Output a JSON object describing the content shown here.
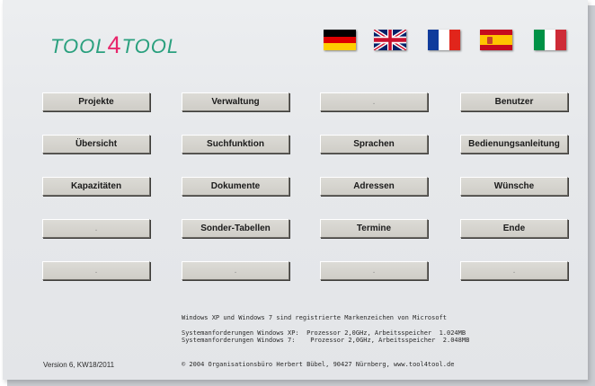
{
  "app": {
    "logo_prefix": "TOOL",
    "logo_four": "4",
    "logo_suffix": "TOOL"
  },
  "flags": [
    {
      "name": "german-flag-icon"
    },
    {
      "name": "uk-flag-icon"
    },
    {
      "name": "french-flag-icon"
    },
    {
      "name": "spanish-flag-icon"
    },
    {
      "name": "italian-flag-icon"
    }
  ],
  "menu": {
    "row1": [
      "Projekte",
      "Verwaltung",
      ".",
      "Benutzer"
    ],
    "row2": [
      "Übersicht",
      "Suchfunktion",
      "Sprachen",
      "Bedienungsanleitung"
    ],
    "row3": [
      "Kapazitäten",
      "Dokumente",
      "Adressen",
      "Wünsche"
    ],
    "row4": [
      ".",
      "Sonder-Tabellen",
      "Termine",
      "Ende"
    ],
    "row5": [
      ".",
      ".",
      ".",
      "."
    ]
  },
  "footer": {
    "trademark": "Windows XP und Windows 7 sind registrierte Markenzeichen von Microsoft",
    "req_xp": "Systemanforderungen Windows XP:  Prozessor 2,0GHz, Arbeitsspeicher  1.024MB",
    "req_7": "Systemanforderungen Windows 7:    Prozessor 2,0GHz, Arbeitsspeicher  2.048MB",
    "version": "Version 6, KW18/2011",
    "copyright": "© 2004 Organisationsbüro Herbert Bübel, 90427 Nürnberg, www.tool4tool.de"
  },
  "colors": {
    "logo_green": "#2aa07e",
    "logo_pink": "#e8266b",
    "panel_bg": "#e6e8eb",
    "button_face": "#d4d2cc"
  }
}
